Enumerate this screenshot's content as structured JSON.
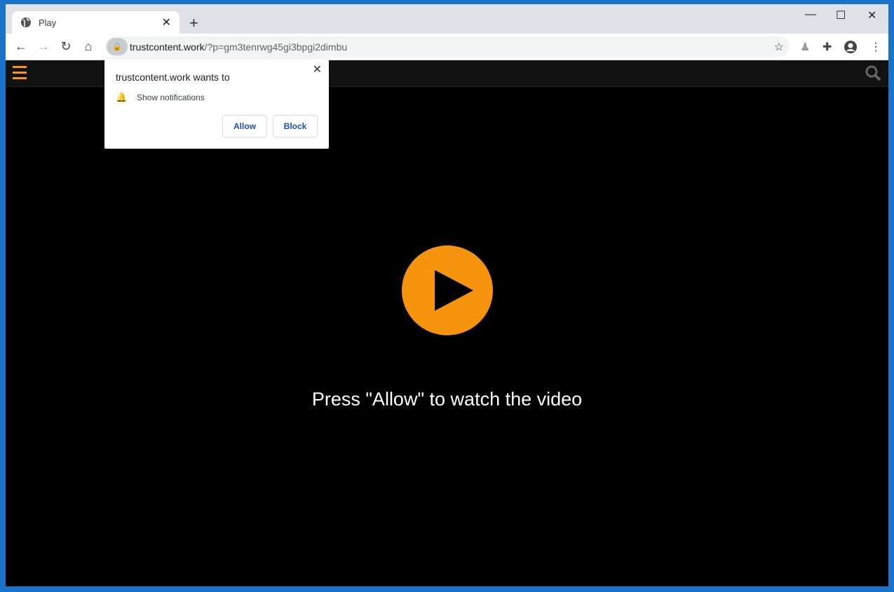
{
  "browser": {
    "tab_title": "Play",
    "url_host": "trustcontent.work",
    "url_rest": "/?p=gm3tenrwg45gi3bpgi2dimbu"
  },
  "popup": {
    "title": "trustcontent.work wants to",
    "permission": "Show notifications",
    "allow": "Allow",
    "block": "Block"
  },
  "page": {
    "message": "Press \"Allow\" to watch the video",
    "accent": "#f7940e"
  }
}
